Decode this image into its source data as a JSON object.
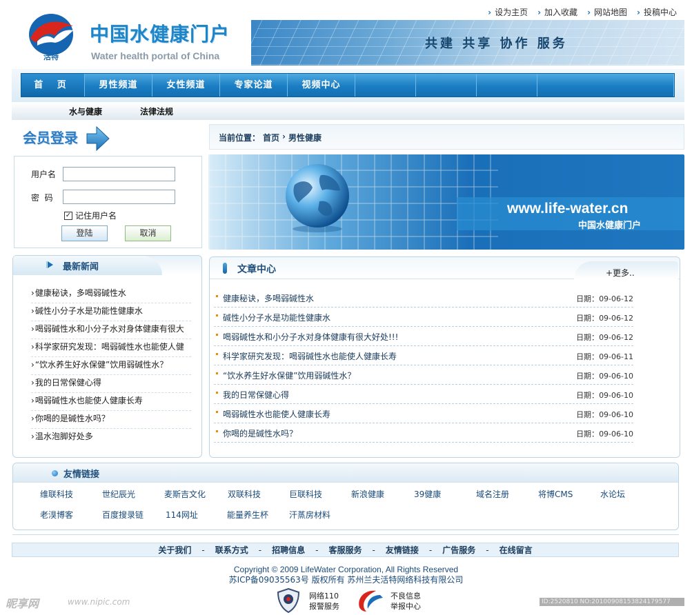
{
  "header": {
    "logo_sub": "活特",
    "site_name_cn": "中国水健康门户",
    "site_name_en": "Water health portal of China",
    "slogan": "共建 共享 协作 服务",
    "top_links": [
      "设为主页",
      "加入收藏",
      "网站地图",
      "投稿中心"
    ]
  },
  "nav": {
    "items": [
      "首 页",
      "男性频道",
      "女性频道",
      "专家论道",
      "视频中心"
    ]
  },
  "subnav": {
    "items": [
      "水与健康",
      "法律法规"
    ]
  },
  "login": {
    "title": "会员登录",
    "username_label": "用户名",
    "username_value": "",
    "password_label": "密  码",
    "password_value": "",
    "remember_label": "记住用户名",
    "remember_checked": true,
    "login_button": "登陆",
    "cancel_button": "取消"
  },
  "breadcrumb": {
    "label": "当前位置：",
    "items": [
      "首页",
      "男性健康"
    ],
    "separator": "›"
  },
  "banner": {
    "url": "www.life-water.cn",
    "name": "中国水健康门户"
  },
  "news": {
    "title": "最新新闻",
    "items": [
      "健康秘诀，多喝弱碱性水",
      "碱性小分子水是功能性健康水",
      "喝弱碱性水和小分子水对身体健康有很大",
      "科学家研究发现：喝弱碱性水也能使人健",
      "“饮水养生好水保健”饮用弱碱性水？",
      "我的日常保健心得",
      "喝弱碱性水也能使人健康长寿",
      "你喝的是碱性水吗？",
      "温水泡脚好处多"
    ]
  },
  "articles": {
    "title": "文章中心",
    "more": "+更多..",
    "date_label": "日期：",
    "items": [
      {
        "title": "健康秘诀，多喝弱碱性水",
        "date": "09-06-12"
      },
      {
        "title": "碱性小分子水是功能性健康水",
        "date": "09-06-12"
      },
      {
        "title": "喝弱碱性水和小分子水对身体健康有很大好处!!!",
        "date": "09-06-12"
      },
      {
        "title": "科学家研究发现：喝弱碱性水也能使人健康长寿",
        "date": "09-06-11"
      },
      {
        "title": "“饮水养生好水保健”饮用弱碱性水？",
        "date": "09-06-10"
      },
      {
        "title": "我的日常保健心得",
        "date": "09-06-10"
      },
      {
        "title": "喝弱碱性水也能使人健康长寿",
        "date": "09-06-10"
      },
      {
        "title": "你喝的是碱性水吗？",
        "date": "09-06-10"
      }
    ]
  },
  "links": {
    "title": "友情链接",
    "items": [
      "维联科技",
      "世纪辰光",
      "麦斯吉文化",
      "双联科技",
      "巨联科技",
      "新浪健康",
      "39健康",
      "域名注册",
      "将博CMS",
      "水论坛",
      "老湨博客",
      "百度搜录链",
      "114网址",
      "能量养生杯",
      "汗蒸房材料"
    ]
  },
  "footer": {
    "links": [
      "关于我们",
      "联系方式",
      "招聘信息",
      "客服服务",
      "友情链接",
      "广告服务",
      "在线留言"
    ],
    "separator": "-",
    "copyright": "Copyright © 2009 LifeWater Corporation, All Rights Reserved",
    "icp": "苏ICP备09035563号 版权所有 苏州兰夫活特网络科技有限公司",
    "badge1_line1": "网络110",
    "badge1_line2": "报警服务",
    "badge2_line1": "不良信息",
    "badge2_line2": "举报中心"
  },
  "watermark": {
    "logo": "昵享网",
    "url": "www.nipic.com",
    "id": "ID:2520810 NO:20100908153824179577"
  },
  "colors": {
    "brand_blue": "#1e86c8",
    "nav_blue": "#1a7dc3",
    "accent_orange": "#f08a00",
    "logo_red": "#d9261c"
  }
}
